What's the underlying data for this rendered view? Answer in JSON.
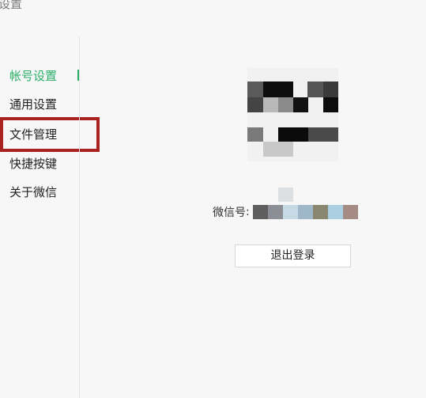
{
  "window": {
    "title": "设置"
  },
  "sidebar": {
    "items": [
      {
        "label": "帐号设置",
        "active": true
      },
      {
        "label": "通用设置",
        "active": false
      },
      {
        "label": "文件管理",
        "active": false
      },
      {
        "label": "快捷按键",
        "active": false
      },
      {
        "label": "关于微信",
        "active": false
      }
    ]
  },
  "account": {
    "wechat_id_label": "微信号",
    "separator": ":",
    "logout_label": "退出登录"
  },
  "colors": {
    "accent": "#2aae67",
    "highlight": "#a9221f"
  }
}
